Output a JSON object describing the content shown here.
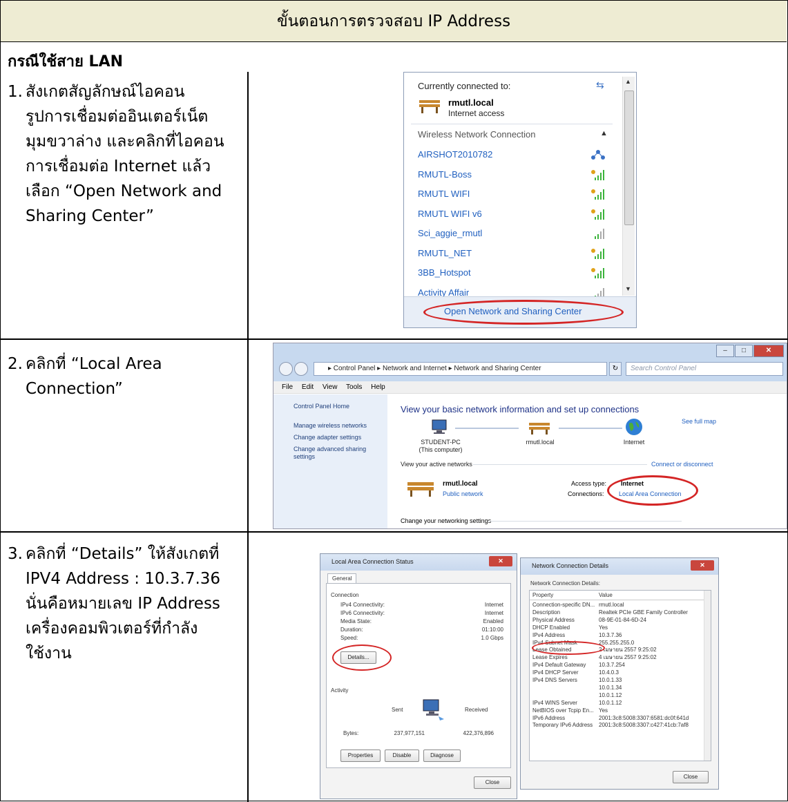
{
  "title": "ขั้นตอนการตรวจสอบ IP Address",
  "section": "กรณีใช้สาย LAN",
  "steps": [
    {
      "num": "1.",
      "lines": [
        "สังเกตสัญลักษณ์ไอคอน",
        "รูปการเชื่อมต่ออินเตอร์เน็ต",
        "มุมขวาล่าง และคลิกที่ไอคอน",
        "การเชื่อมต่อ Internet แล้ว",
        "เลือก “Open Network and",
        "Sharing Center”"
      ]
    },
    {
      "num": "2.",
      "lines": [
        "คลิกที่ “Local Area",
        "Connection”"
      ]
    },
    {
      "num": "3.",
      "lines": [
        "คลิกที่ “Details” ให้สังเกตที่",
        "IPV4 Address : 10.3.7.36",
        "นั่นคือหมายเลข IP Address",
        "เครื่องคอมพิวเตอร์ที่กำลัง",
        "ใช้งาน"
      ]
    }
  ],
  "popup": {
    "currently": "Currently connected to:",
    "conn_name": "rmutl.local",
    "conn_sub": "Internet access",
    "group": "Wireless Network Connection",
    "networks": [
      "AIRSHOT2010782",
      "RMUTL-Boss",
      "RMUTL WIFI",
      "RMUTL WIFI v6",
      "Sci_aggie_rmutl",
      "RMUTL_NET",
      "3BB_Hotspot",
      "Activity Affair"
    ],
    "footer_link": "Open Network and Sharing Center"
  },
  "nsc": {
    "address": "▸ Control Panel ▸ Network and Internet ▸ Network and Sharing Center",
    "search_placeholder": "Search Control Panel",
    "menu": [
      "File",
      "Edit",
      "View",
      "Tools",
      "Help"
    ],
    "left_links": [
      "Control Panel Home",
      "Manage wireless networks",
      "Change adapter settings",
      "Change advanced sharing",
      "settings"
    ],
    "heading": "View your basic network information and set up connections",
    "see_full_map": "See full map",
    "pc_name": "STUDENT-PC",
    "pc_sub": "(This computer)",
    "mid_name": "rmutl.local",
    "internet": "Internet",
    "active_networks": "View your active networks",
    "connect_disconnect": "Connect or disconnect",
    "net_name": "rmutl.local",
    "net_type": "Public network",
    "access_type_label": "Access type:",
    "access_type_value": "Internet",
    "connections_label": "Connections:",
    "connections_value": "Local Area Connection",
    "change_settings": "Change your networking settings"
  },
  "status": {
    "title": "Local Area Connection Status",
    "tab": "General",
    "connection": "Connection",
    "rows": [
      {
        "label": "IPv4 Connectivity:",
        "value": "Internet"
      },
      {
        "label": "IPv6 Connectivity:",
        "value": "Internet"
      },
      {
        "label": "Media State:",
        "value": "Enabled"
      },
      {
        "label": "Duration:",
        "value": "01:10:00"
      },
      {
        "label": "Speed:",
        "value": "1.0 Gbps"
      }
    ],
    "details_btn": "Details...",
    "activity": "Activity",
    "sent": "Sent",
    "received": "Received",
    "bytes": "Bytes:",
    "bytes_sent": "237,977,151",
    "bytes_recv": "422,376,896",
    "properties": "Properties",
    "disable": "Disable",
    "diagnose": "Diagnose",
    "close": "Close"
  },
  "details": {
    "title": "Network Connection Details",
    "caption": "Network Connection Details:",
    "col_property": "Property",
    "col_value": "Value",
    "rows": [
      {
        "p": "Connection-specific DN...",
        "v": "rmutl.local"
      },
      {
        "p": "Description",
        "v": "Realtek PCIe GBE Family Controller"
      },
      {
        "p": "Physical Address",
        "v": "08-9E-01-84-6D-24"
      },
      {
        "p": "DHCP Enabled",
        "v": "Yes"
      },
      {
        "p": "IPv4 Address",
        "v": "10.3.7.36"
      },
      {
        "p": "IPv4 Subnet Mask",
        "v": "255.255.255.0"
      },
      {
        "p": "Lease Obtained",
        "v": "2 เมษายน 2557 9:25:02"
      },
      {
        "p": "Lease Expires",
        "v": "4 เมษายน 2557 9:25:02"
      },
      {
        "p": "IPv4 Default Gateway",
        "v": "10.3.7.254"
      },
      {
        "p": "IPv4 DHCP Server",
        "v": "10.4.0.3"
      },
      {
        "p": "IPv4 DNS Servers",
        "v": "10.0.1.33"
      },
      {
        "p": "",
        "v": "10.0.1.34"
      },
      {
        "p": "",
        "v": "10.0.1.12"
      },
      {
        "p": "IPv4 WINS Server",
        "v": "10.0.1.12"
      },
      {
        "p": "NetBIOS over Tcpip En...",
        "v": "Yes"
      },
      {
        "p": "IPv6 Address",
        "v": "2001:3c8:5008:3307:6581:dc0f:641d"
      },
      {
        "p": "Temporary IPv6 Address",
        "v": "2001:3c8:5008:3307:c427:41cb:7af8"
      }
    ],
    "close": "Close"
  },
  "colors": {
    "title_bg": "#eeecd3",
    "highlight_ring": "#d42525",
    "link": "#1f5fbf"
  }
}
